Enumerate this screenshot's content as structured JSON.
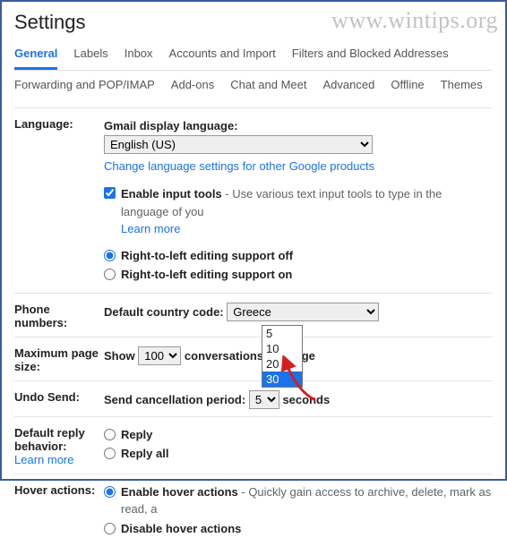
{
  "watermark": "www.wintips.org",
  "page_title": "Settings",
  "tabs_row1": {
    "general": "General",
    "labels": "Labels",
    "inbox": "Inbox",
    "accounts": "Accounts and Import",
    "filters": "Filters and Blocked Addresses"
  },
  "tabs_row2": {
    "forwarding": "Forwarding and POP/IMAP",
    "addons": "Add-ons",
    "chat": "Chat and Meet",
    "advanced": "Advanced",
    "offline": "Offline",
    "themes": "Themes"
  },
  "language": {
    "label": "Language:",
    "display_label": "Gmail display language:",
    "display_value": "English (US)",
    "change_link": "Change language settings for other Google products",
    "enable_tools_label": "Enable input tools",
    "enable_tools_desc": " - Use various text input tools to type in the language of you",
    "learn_more": "Learn more",
    "rtl_off": "Right-to-left editing support off",
    "rtl_on": "Right-to-left editing support on"
  },
  "phone": {
    "label": "Phone numbers:",
    "code_label": "Default country code:",
    "code_value": "Greece"
  },
  "pagesize": {
    "label": "Maximum page size:",
    "show": "Show",
    "value": "100",
    "suffix": " conversations per page"
  },
  "undo": {
    "label": "Undo Send:",
    "period_label": "Send cancellation period:",
    "period_value": "5",
    "suffix": " seconds",
    "options": {
      "o5": "5",
      "o10": "10",
      "o20": "20",
      "o30": "30"
    }
  },
  "reply": {
    "label": "Default reply behavior:",
    "learn_more": "Learn more",
    "reply": "Reply",
    "reply_all": "Reply all"
  },
  "hover": {
    "label": "Hover actions:",
    "enable_label": "Enable hover actions",
    "enable_desc": " - Quickly gain access to archive, delete, mark as read, a",
    "disable_label": "Disable hover actions"
  }
}
